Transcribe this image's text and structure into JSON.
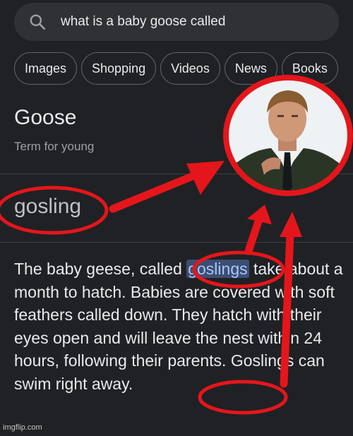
{
  "search": {
    "query": "what is a baby goose called"
  },
  "tabs": [
    "Images",
    "Shopping",
    "Videos",
    "News",
    "Books"
  ],
  "knowledge_panel": {
    "title": "Goose",
    "subtitle": "Term for young",
    "answer": "gosling"
  },
  "snippet": {
    "p1": "The baby geese, called ",
    "h1": "goslings",
    "p2": " take about a month to hatch. Babies are covered with soft feathers called down. They hatch with their eyes open and will leave the nest within 24 hours, following their parents. ",
    "h2": "Goslings",
    "p3": " can swim right away."
  },
  "watermark": "imgflip.com",
  "colors": {
    "background": "#202124",
    "highlight": "#3c4e73",
    "annotation": "#e4161b"
  }
}
